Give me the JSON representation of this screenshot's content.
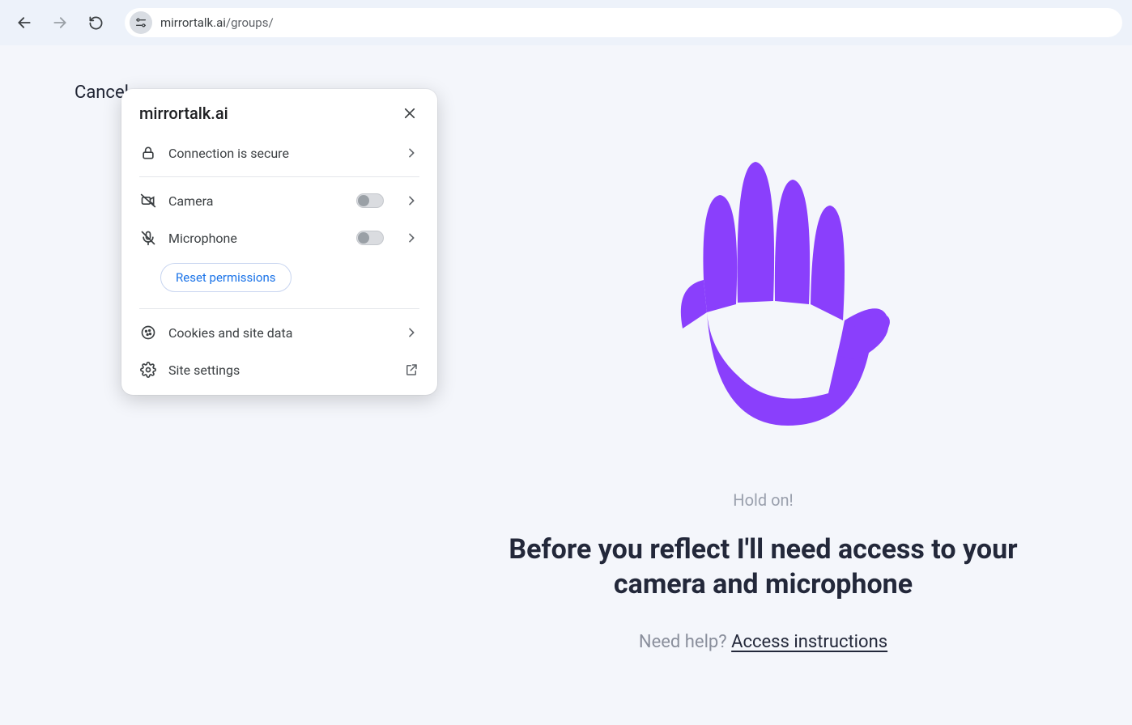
{
  "toolbar": {
    "url_host": "mirrortalk.ai",
    "url_path": "/groups/"
  },
  "page": {
    "cancel": "Cancel",
    "hold_on": "Hold on!",
    "headline": "Before you reflect I'll need access to your camera and microphone",
    "help_prefix": "Need help? ",
    "help_link": "Access instructions"
  },
  "popup": {
    "title": "mirrortalk.ai",
    "connection": "Connection is secure",
    "camera": "Camera",
    "microphone": "Microphone",
    "reset": "Reset permissions",
    "cookies": "Cookies and site data",
    "site_settings": "Site settings"
  }
}
